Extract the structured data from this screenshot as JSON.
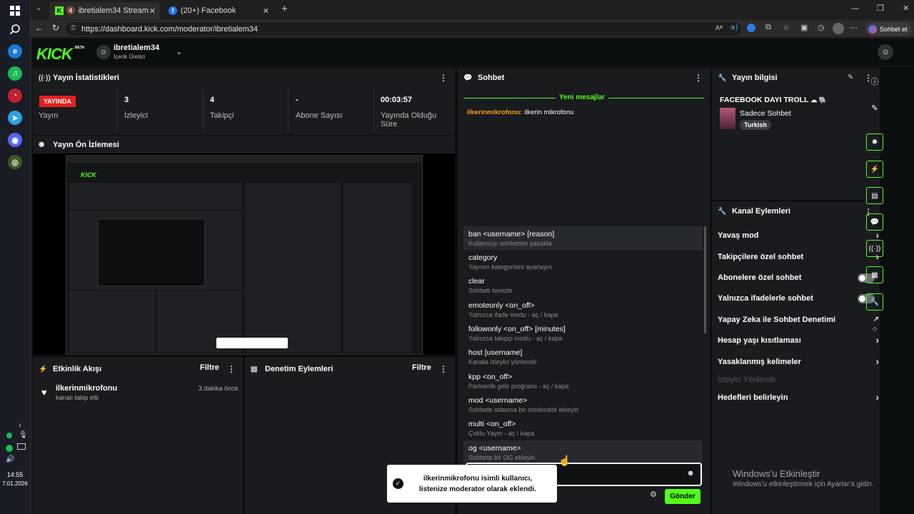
{
  "taskbar": {
    "clock_time": "14:55",
    "clock_date": "7.01.2026"
  },
  "browser": {
    "tabs": [
      {
        "label": "ibretialem34 Stream - Kick Da"
      },
      {
        "label": "(20+) Facebook"
      }
    ],
    "url": "https://dashboard.kick.com/moderator/ibretialem34",
    "chat_button": "Sohbet et"
  },
  "kick": {
    "logo": "KICK",
    "beta": "BETA",
    "channel_name": "ibretialem34",
    "channel_role": "İçerik Üretici",
    "stats_panel": {
      "title": "Yayın İstatistikleri",
      "live_badge": "YAYINDA",
      "live_label": "Yayın",
      "items": [
        {
          "value": "3",
          "label": "İzleyici"
        },
        {
          "value": "4",
          "label": "Takipçi"
        },
        {
          "value": "-",
          "label": "Abone Sayısı"
        },
        {
          "value": "00:03:57",
          "label": "Yayında Olduğu Süre"
        }
      ]
    },
    "preview_panel": {
      "title": "Yayın Ön İzlemesi"
    },
    "activity_panel": {
      "title": "Etkinlik Akışı",
      "filter": "Filtre",
      "event_user": "ilkerinmikrofonu",
      "event_text": "kanalı takip etti",
      "event_time": "3 dakika önce"
    },
    "moderation_panel": {
      "title": "Denetim Eylemleri",
      "filter": "Filtre"
    },
    "chat_panel": {
      "title": "Sohbet",
      "new_messages": "Yeni mesajlar",
      "msg_user": "ilkerinmikrofonu:",
      "msg_text": "ilkerin mikrofonu",
      "send_button": "Gönder",
      "commands": [
        {
          "name": "ban <username> [reason]",
          "desc": "Kullanıcıyı sohbetten yasakla"
        },
        {
          "name": "category",
          "desc": "Yayının kategorisini ayarlayın"
        },
        {
          "name": "clear",
          "desc": "Sohbeti temizle"
        },
        {
          "name": "emoteonly <on_off>",
          "desc": "Yalnızca ifade modu - aç / kapa"
        },
        {
          "name": "followonly <on_off> [minutes]",
          "desc": "Yalnızca takipçi modu - aç / kapa"
        },
        {
          "name": "host [username]",
          "desc": "Kanala izleyici yönlendir"
        },
        {
          "name": "kpp <on_off>",
          "desc": "Partnerlik gelir programı - aç / kapa"
        },
        {
          "name": "mod <username>",
          "desc": "Sohbete odasına bir moderatör ekleyin"
        },
        {
          "name": "multi <on_off>",
          "desc": "Çoklu Yayın - aç / kapa"
        },
        {
          "name": "og <username>",
          "desc": "Sohbete bir OG ekleyin"
        }
      ]
    },
    "stream_info": {
      "title": "Yayın bilgisi",
      "stream_title": "FACEBOOK DAYI TROLL",
      "category": "Sadece Sohbet",
      "tag": "Turkish"
    },
    "channel_actions": {
      "title": "Kanal Eylemleri",
      "items": [
        {
          "label": "Yavaş mod",
          "control": "chevron"
        },
        {
          "label": "Takipçilere özel sohbet",
          "control": "chevron"
        },
        {
          "label": "Abonelere özel sohbet",
          "control": "toggle"
        },
        {
          "label": "Yalnızca ifadelerle sohbet",
          "control": "toggle"
        },
        {
          "label": "Yapay Zeka ile Sohbet Denetimi",
          "control": "external"
        },
        {
          "label": "Hesap yaşı kısıtlaması",
          "control": "chevron"
        },
        {
          "label": "Yasaklanmış kelimeler",
          "control": "chevron"
        },
        {
          "label": "İzleyici Yönlendir",
          "control": "disabled"
        },
        {
          "label": "Hedefleri belirleyin",
          "control": "chevron"
        }
      ]
    },
    "toast": "ilkerinmikrofonu isimli kullanıcı, listenize moderator olarak eklendi."
  },
  "watermark": {
    "title": "Windows'u Etkinleştir",
    "subtitle": "Windows'u etkinleştirmek için Ayarlar'a gidin."
  },
  "colors": {
    "accent": "#53fc18",
    "live": "#e4201e"
  }
}
